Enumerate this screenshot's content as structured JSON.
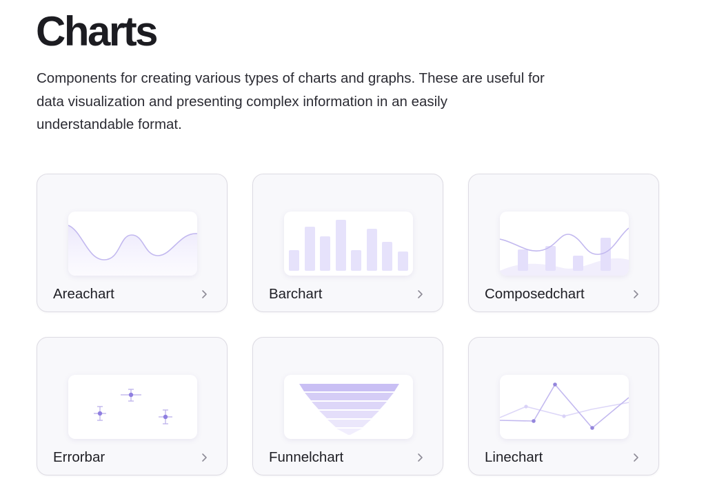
{
  "page": {
    "title": "Charts",
    "description": "Components for creating various types of charts and graphs. These are useful for data visualization and presenting complex information in an easily understandable format."
  },
  "colors": {
    "accent": "#8f7fe0",
    "accent_light": "#e6e2fb",
    "line_light": "#c9c0f2",
    "chevron": "#8d8b96"
  },
  "cards": [
    {
      "label": "Areachart",
      "icon": "area-chart-icon"
    },
    {
      "label": "Barchart",
      "icon": "bar-chart-icon"
    },
    {
      "label": "Composedchart",
      "icon": "composed-chart-icon"
    },
    {
      "label": "Errorbar",
      "icon": "error-bar-chart-icon"
    },
    {
      "label": "Funnelchart",
      "icon": "funnel-chart-icon"
    },
    {
      "label": "Linechart",
      "icon": "line-chart-icon"
    }
  ]
}
